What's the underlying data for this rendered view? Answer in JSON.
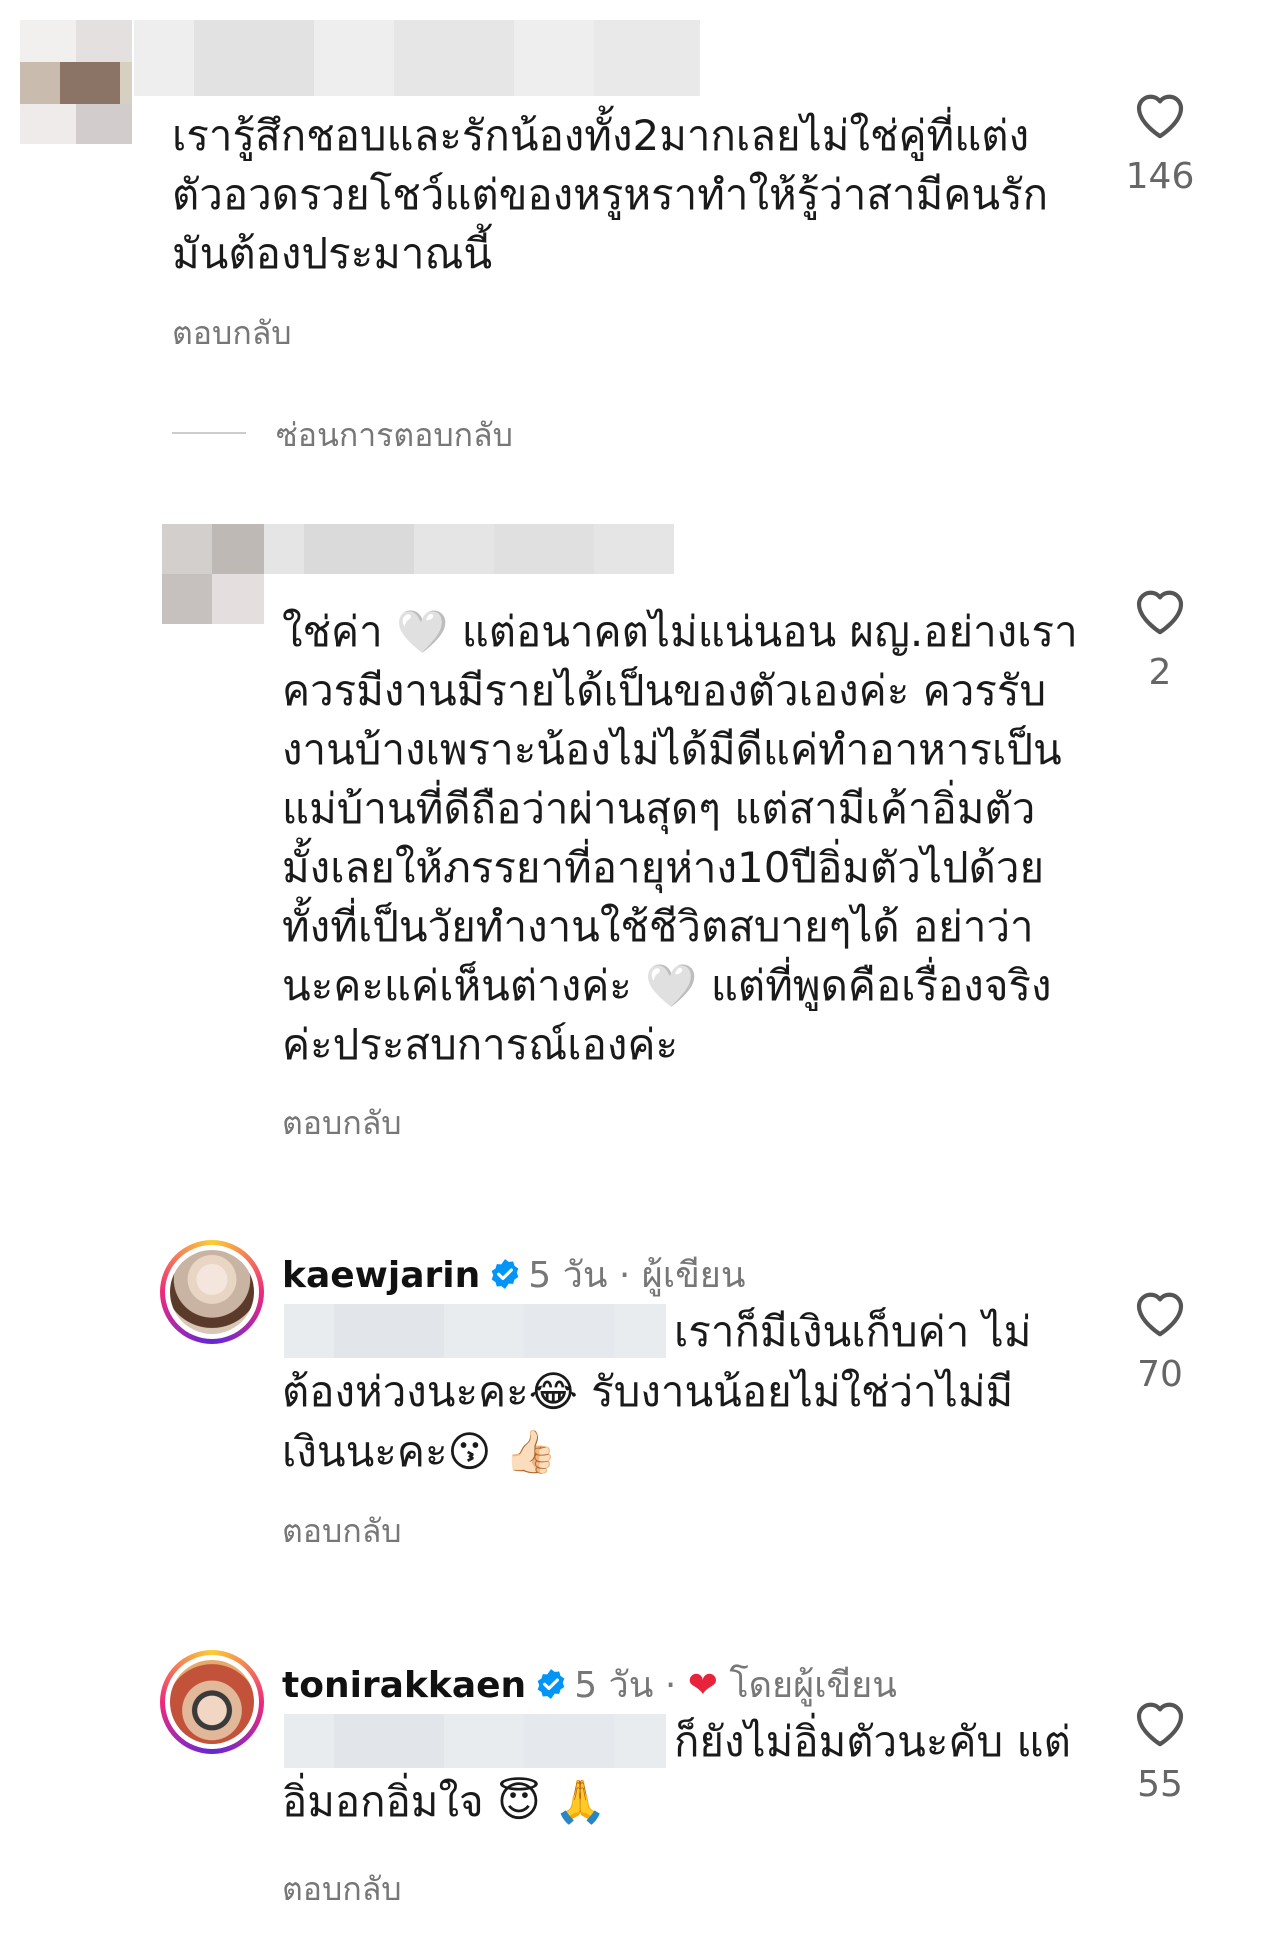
{
  "comments": [
    {
      "text_lines": [
        "เรารู้สึกชอบและรักน้องทั้ง2มากเลยไม่ใช่คู่ที่แต่ง",
        "ตัวอวดรวยโชว์แต่ของหรูหราทำให้รู้ว่าสามีคนรัก",
        "มันต้องประมาณนี้"
      ],
      "reply_label": "ตอบกลับ",
      "likes": "146",
      "hide_replies_label": "ซ่อนการตอบกลับ"
    },
    {
      "text_lines": [
        "ใช่ค่า 🤍 แต่อนาคตไม่แน่นอน ผญ.อย่างเรา",
        "ควรมีงานมีรายได้เป็นของตัวเองค่ะ ควรรับ",
        "งานบ้างเพราะน้องไม่ได้มีดีแค่ทำอาหารเป็น",
        "แม่บ้านที่ดีถือว่าผ่านสุดๆ แต่สามีเค้าอิ่มตัว",
        "มั้งเลยให้ภรรยาที่อายุห่าง10ปีอิ่มตัวไปด้วย",
        "ทั้งที่เป็นวัยทำงานใช้ชีวิตสบายๆได้ อย่าว่า",
        "นะคะแค่เห็นต่างค่ะ 🤍 แต่ที่พูดคือเรื่องจริง",
        "ค่ะประสบการณ์เองค่ะ"
      ],
      "reply_label": "ตอบกลับ",
      "likes": "2"
    },
    {
      "username": "kaewjarin",
      "time": "5 วัน",
      "separator": "·",
      "author_tag": "ผู้เขียน",
      "line1": "เราก็มีเงินเก็บค่า ไม่",
      "line2": "ต้องห่วงนะคะ",
      "line2_emoji": "😂",
      "line2_rest": "รับงานน้อยไม่ใช่ว่าไม่มี",
      "line3": "เงินนะคะ",
      "line3_emoji_a": "😗",
      "line3_emoji_b": "👍🏻",
      "reply_label": "ตอบกลับ",
      "likes": "70"
    },
    {
      "username": "tonirakkaen",
      "time": "5 วัน",
      "separator": "·",
      "author_tag": "โดยผู้เขียน",
      "heart": "❤",
      "line1": "ก็ยังไม่อิ่มตัวนะคับ แต่",
      "line2": "อิ่มอกอิ่มใจ",
      "line2_emoji_a": "😇",
      "line2_emoji_b": "🙏",
      "reply_label": "ตอบกลับ",
      "likes": "55"
    }
  ],
  "colors": {
    "text": "#1a1a1a",
    "muted": "#777777",
    "verified": "#0095f6",
    "heart_red": "#e8243c"
  },
  "icons": {
    "like": "heart-outline-icon",
    "verified": "verified-badge-icon"
  }
}
